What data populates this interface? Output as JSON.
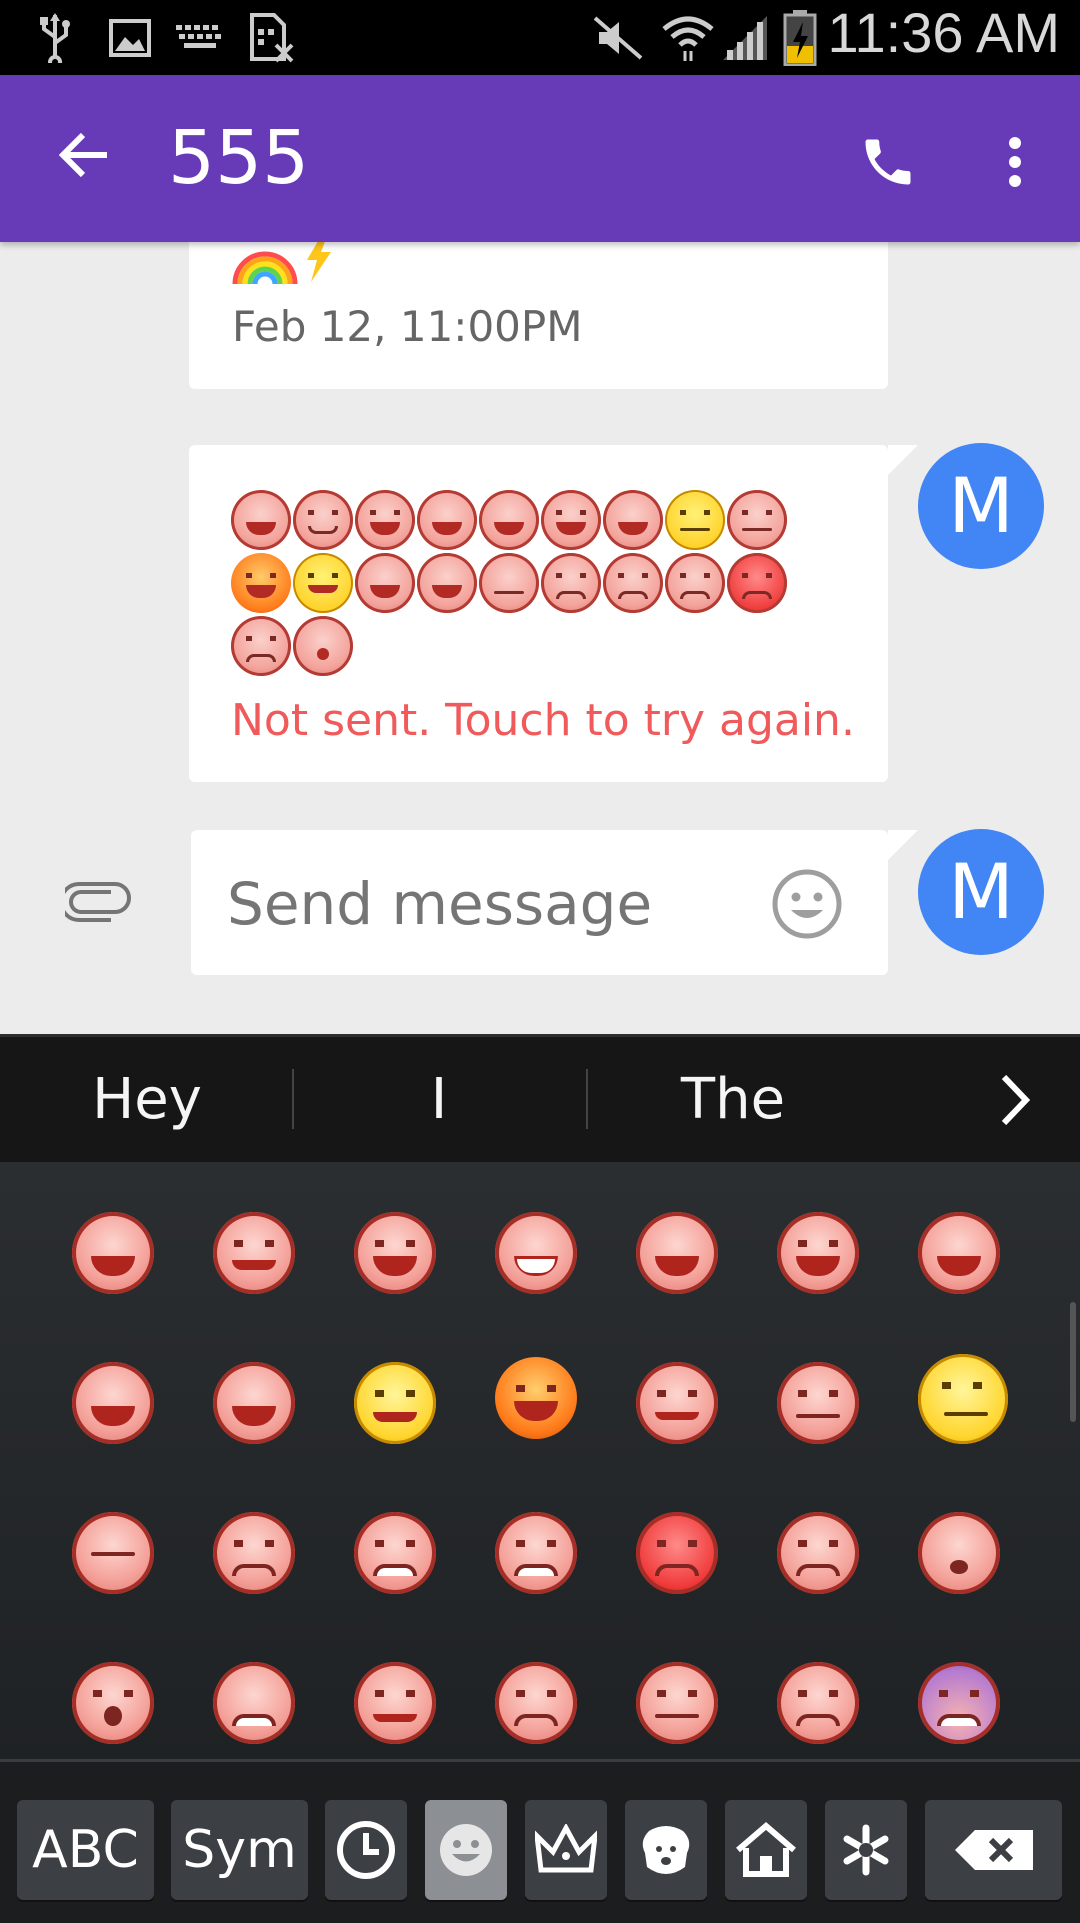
{
  "status_bar": {
    "time": "11:36 AM",
    "icons": [
      "usb-icon",
      "image-icon",
      "keyboard-icon",
      "sim-off-icon",
      "mute-icon",
      "wifi-icon",
      "signal-icon",
      "battery-charging-icon"
    ]
  },
  "app_bar": {
    "title": "555",
    "back_icon": "back-arrow-icon",
    "call_icon": "phone-icon",
    "menu_icon": "overflow-menu-icon",
    "color": "#673ab7"
  },
  "messages": [
    {
      "emoji": [
        "rainbow",
        "lightning"
      ],
      "timestamp": "Feb 12, 11:00PM"
    },
    {
      "emoji": [
        "grinning-closed-eyes",
        "blushing-smile",
        "grinning",
        "smiling-eyes",
        "tears-of-joy",
        "grinning",
        "grinning",
        "neutral-yellow",
        "neutral",
        "smiling-devil",
        "angel",
        "laughing-squint",
        "sweat-smile",
        "expressionless",
        "worried",
        "frowning",
        "grimacing",
        "angry",
        "sad-tear",
        "sleepy"
      ],
      "status": "Not sent. Touch to try again.",
      "status_color": "#f05a5a",
      "avatar_letter": "M"
    }
  ],
  "compose": {
    "placeholder": "Send message",
    "avatar_letter": "M",
    "attach_icon": "paperclip-icon",
    "emoji_icon": "smiley-icon"
  },
  "keyboard": {
    "suggestions": [
      "Hey",
      "I",
      "The"
    ],
    "more_icon": "chevron-right-icon",
    "emoji_grid": [
      [
        "grinning-closed-eyes",
        "blushing-smile",
        "grinning",
        "smiling-eyes",
        "tears-of-joy",
        "grinning",
        "grinning"
      ],
      [
        "sweat-smile",
        "laughing-squint",
        "angel",
        "smiling-devil",
        "winking",
        "neutral",
        "neutral-yellow"
      ],
      [
        "expressionless",
        "frowning",
        "angry-open",
        "grimacing",
        "pouting",
        "sad-tear",
        "sleepy"
      ],
      [
        "surprised",
        "persevering",
        "smirk",
        "sweat-frown",
        "unamused",
        "worried",
        "fearful"
      ]
    ],
    "bottom_keys": {
      "abc": "ABC",
      "sym": "Sym",
      "icons": [
        "recent-clock-icon",
        "smiley-icon",
        "crown-icon",
        "dog-icon",
        "house-icon",
        "asterisk-icon"
      ],
      "delete_icon": "backspace-icon"
    }
  }
}
